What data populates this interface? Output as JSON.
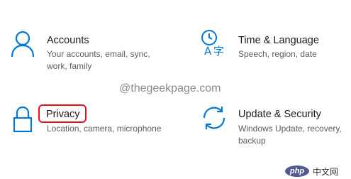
{
  "settings": {
    "tiles": [
      {
        "title": "Accounts",
        "description": "Your accounts, email, sync, work, family",
        "icon": "person-icon"
      },
      {
        "title": "Time & Language",
        "description": "Speech, region, date",
        "icon": "time-language-icon"
      },
      {
        "title": "Privacy",
        "description": "Location, camera, microphone",
        "icon": "lock-icon"
      },
      {
        "title": "Update & Security",
        "description": "Windows Update, recovery, backup",
        "icon": "update-sync-icon"
      }
    ]
  },
  "watermark": {
    "text": "@thegeekpage.com"
  },
  "badge": {
    "logo_text": "php",
    "label": "中文网"
  },
  "colors": {
    "accent": "#0078d7",
    "highlight": "#e0141b",
    "title_text": "#1a1a1a",
    "description_text": "#5d5d5d"
  }
}
